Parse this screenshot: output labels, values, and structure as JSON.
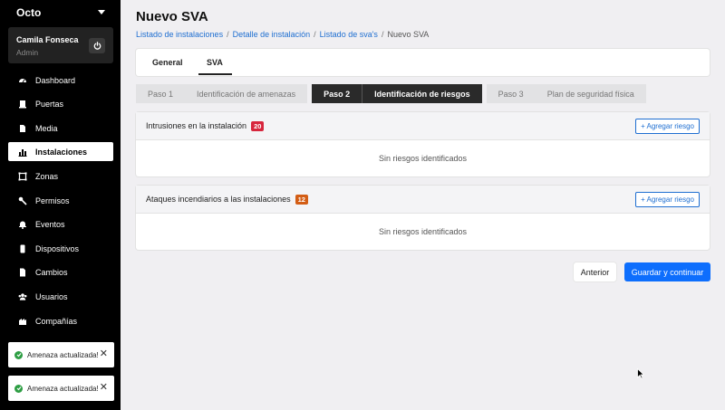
{
  "sidebar": {
    "brand": "Octo",
    "user": {
      "name": "Camila Fonseca",
      "role": "Admin"
    },
    "items": [
      {
        "label": "Dashboard",
        "icon": "dashboard-icon",
        "active": false
      },
      {
        "label": "Puertas",
        "icon": "door-icon",
        "active": false
      },
      {
        "label": "Media",
        "icon": "media-icon",
        "active": false
      },
      {
        "label": "Instalaciones",
        "icon": "chart-icon",
        "active": true
      },
      {
        "label": "Zonas",
        "icon": "zones-icon",
        "active": false
      },
      {
        "label": "Permisos",
        "icon": "key-icon",
        "active": false
      },
      {
        "label": "Eventos",
        "icon": "bell-icon",
        "active": false
      },
      {
        "label": "Dispositivos",
        "icon": "device-icon",
        "active": false
      },
      {
        "label": "Cambios",
        "icon": "file-icon",
        "active": false
      },
      {
        "label": "Usuarios",
        "icon": "users-icon",
        "active": false
      },
      {
        "label": "Compañías",
        "icon": "company-icon",
        "active": false
      }
    ]
  },
  "toasts": [
    {
      "text": "Amenaza actualizada!"
    },
    {
      "text": "Amenaza actualizada!"
    }
  ],
  "page": {
    "title": "Nuevo SVA",
    "breadcrumb": [
      "Listado de instalaciones",
      "Detalle de instalación",
      "Listado de sva's",
      "Nuevo SVA"
    ]
  },
  "tabs": [
    "General",
    "SVA"
  ],
  "steps": [
    {
      "num": "Paso 1",
      "label": "Identificación de amenazas",
      "active": false
    },
    {
      "num": "Paso 2",
      "label": "Identificación de riesgos",
      "active": true
    },
    {
      "num": "Paso 3",
      "label": "Plan de seguridad física",
      "active": false
    }
  ],
  "risks": [
    {
      "title": "Intrusiones en la instalación",
      "count": "20",
      "add_label": "+ Agregar riesgo",
      "empty": "Sin riesgos identificados"
    },
    {
      "title": "Ataques incendiarios a las instalaciones",
      "count": "12",
      "add_label": "+ Agregar riesgo",
      "empty": "Sin riesgos identificados"
    }
  ],
  "actions": {
    "prev": "Anterior",
    "save": "Guardar y continuar"
  },
  "colors": {
    "primary": "#0d6efd",
    "link": "#1f6fd1",
    "badge_red": "#d7263d",
    "badge_orange": "#d35d15",
    "success": "#2e9e44"
  }
}
